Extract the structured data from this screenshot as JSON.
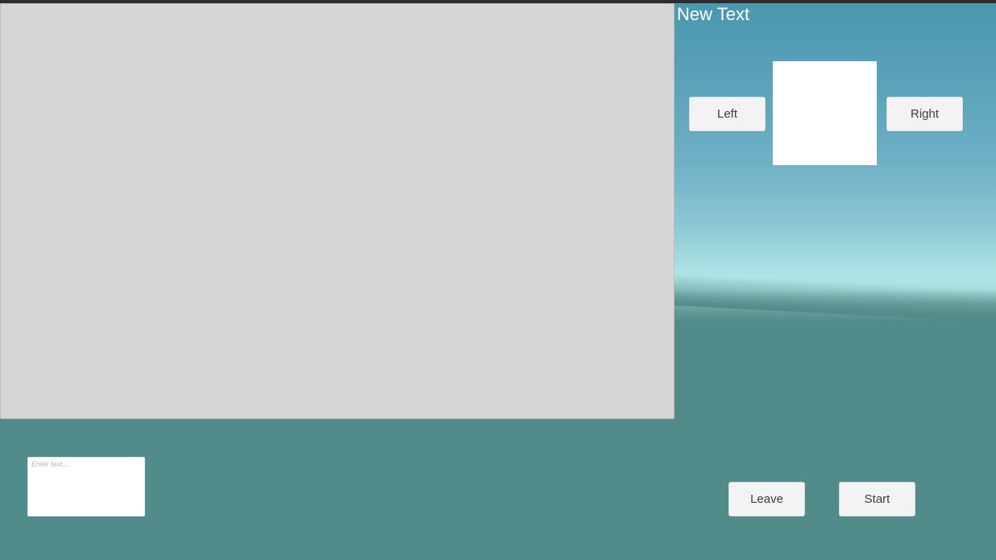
{
  "header": {
    "title": "New Text"
  },
  "selector": {
    "left_label": "Left",
    "right_label": "Right"
  },
  "chat": {
    "input_value": "",
    "input_placeholder": "Enter text..."
  },
  "actions": {
    "leave_label": "Leave",
    "start_label": "Start"
  },
  "colors": {
    "panel": "#d6d6d6",
    "button": "#f3f3f3",
    "button_text": "#3c3c3c",
    "sky_top": "#4b97ad",
    "horizon": "#b0e5e6",
    "ground": "#528c8a",
    "title_text": "#ffffff"
  }
}
